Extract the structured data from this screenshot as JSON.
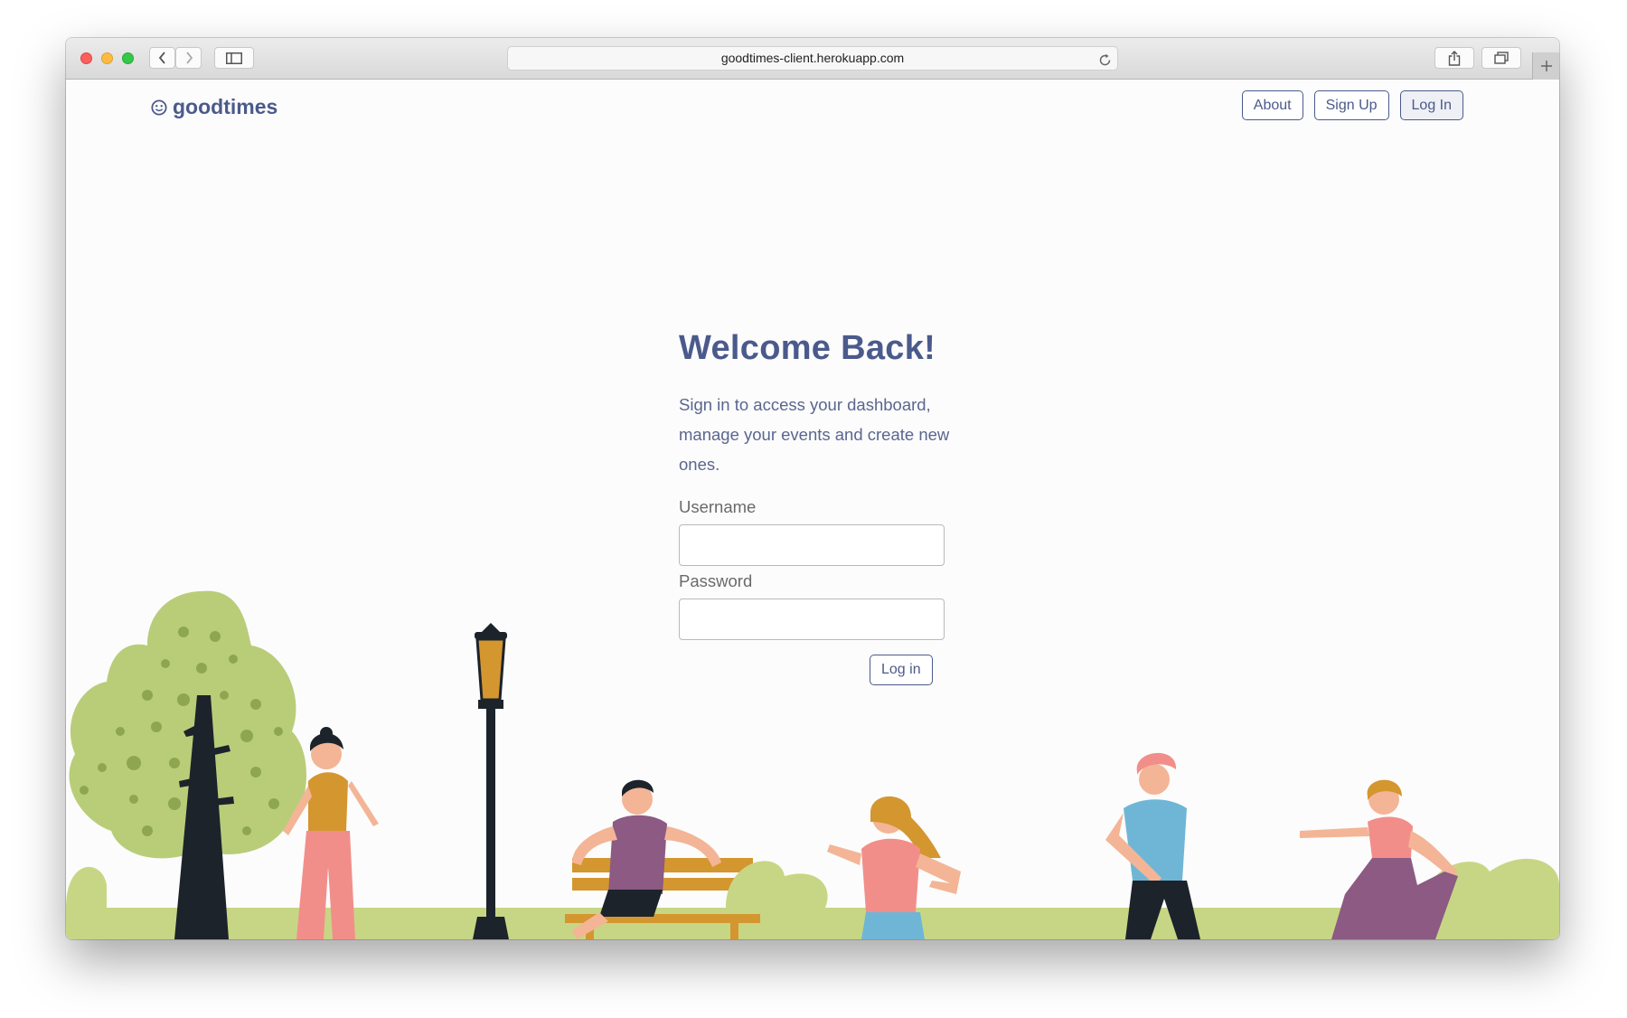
{
  "browser": {
    "url": "goodtimes-client.herokuapp.com"
  },
  "header": {
    "brand": "goodtimes",
    "nav": [
      {
        "label": "About"
      },
      {
        "label": "Sign Up"
      },
      {
        "label": "Log In"
      }
    ]
  },
  "login": {
    "title": "Welcome Back!",
    "subtitle": "Sign in to access your dashboard, manage your events and create new ones.",
    "username_label": "Username",
    "username_value": "",
    "password_label": "Password",
    "password_value": "",
    "submit_label": "Log in"
  },
  "colors": {
    "brand": "#4b5a8c",
    "ground": "#c7d685",
    "tree": "#b8cc78"
  }
}
